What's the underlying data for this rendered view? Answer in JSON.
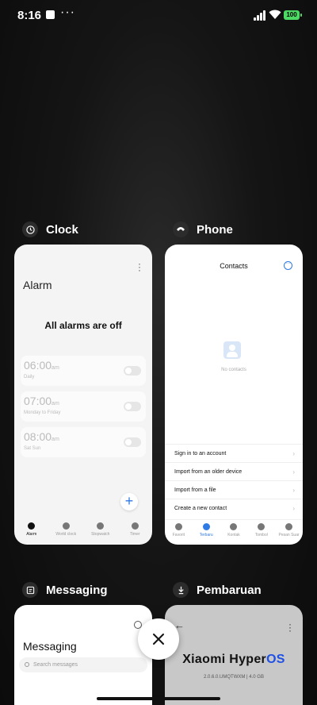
{
  "status_bar": {
    "time": "8:16",
    "more": "···",
    "battery": "100"
  },
  "apps": {
    "clock": {
      "name": "Clock"
    },
    "phone": {
      "name": "Phone"
    },
    "messaging": {
      "name": "Messaging"
    },
    "update": {
      "name": "Pembaruan"
    }
  },
  "clock_card": {
    "title": "Alarm",
    "empty_text": "All alarms are off",
    "alarms": [
      {
        "time": "06:00",
        "ampm": "am",
        "repeat": "Daily"
      },
      {
        "time": "07:00",
        "ampm": "am",
        "repeat": "Monday to Friday"
      },
      {
        "time": "08:00",
        "ampm": "am",
        "repeat": "Sat Sun"
      }
    ],
    "add_label": "+",
    "nav": [
      "Alarm",
      "World clock",
      "Stopwatch",
      "Timer"
    ]
  },
  "phone_card": {
    "title": "Contacts",
    "empty_text": "No contacts",
    "options": [
      "Sign in to an account",
      "Import from an older device",
      "Import from a file",
      "Create a new contact"
    ],
    "nav": [
      "Favorit",
      "Terbaru",
      "Kontak",
      "Tombol",
      "Pesan Suar"
    ]
  },
  "messaging_card": {
    "title": "Messaging",
    "search_placeholder": "Search messages"
  },
  "update_card": {
    "brand_a": "Xiaomi Hyper",
    "brand_b": "OS",
    "version": "2.0.6.0.UMQTWXM | 4.0 GB"
  }
}
